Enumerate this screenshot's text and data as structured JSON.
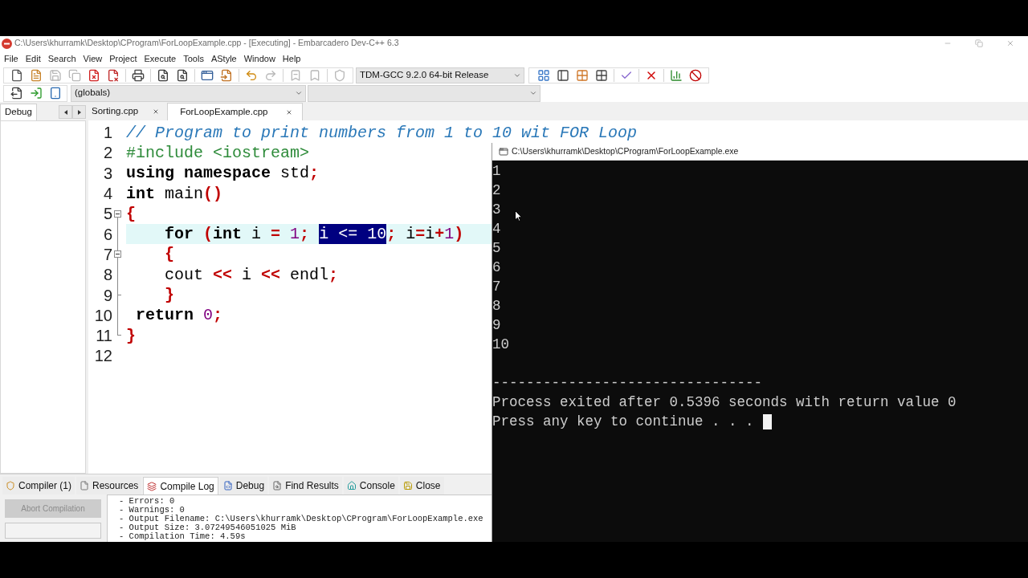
{
  "window": {
    "title": "C:\\Users\\khurramk\\Desktop\\CProgram\\ForLoopExample.cpp - [Executing] - Embarcadero Dev-C++ 6.3"
  },
  "menu": [
    "File",
    "Edit",
    "Search",
    "View",
    "Project",
    "Execute",
    "Tools",
    "AStyle",
    "Window",
    "Help"
  ],
  "main_toolbar": {
    "left_groups": [
      [
        {
          "disabled": false
        },
        {
          "disabled": false
        },
        {
          "disabled": true
        },
        {
          "disabled": true
        },
        {
          "disabled": false
        },
        {
          "disabled": false
        }
      ],
      [
        {
          "disabled": false
        }
      ],
      [
        {
          "disabled": false
        },
        {
          "disabled": false
        }
      ],
      [
        {
          "disabled": false
        },
        {
          "disabled": false
        }
      ],
      [
        {
          "disabled": false
        },
        {
          "disabled": true
        }
      ],
      [
        {
          "disabled": true
        },
        {
          "disabled": true
        }
      ],
      [
        {
          "disabled": true
        }
      ]
    ],
    "compiler": "TDM-GCC 9.2.0 64-bit Release",
    "right_groups": [
      [
        {
          "disabled": false
        },
        {
          "disabled": false
        },
        {
          "disabled": false
        },
        {
          "disabled": false
        }
      ],
      [
        {
          "disabled": false
        }
      ],
      [
        {
          "disabled": false
        }
      ],
      [
        {
          "disabled": false
        },
        {
          "disabled": false
        }
      ]
    ]
  },
  "class_toolbar": {
    "scope": "(globals)"
  },
  "left_panel": {
    "tabs": [
      {
        "label": "Debug",
        "selected": true
      }
    ]
  },
  "editor": {
    "tabs": [
      {
        "label": "Sorting.cpp",
        "selected": false
      },
      {
        "label": "ForLoopExample.cpp",
        "selected": true
      }
    ],
    "lines": [
      {
        "number": "1",
        "current": false,
        "tokens": [
          {
            "kind": "comment",
            "text": "// Program to print numbers from 1 to 10 wit FOR Loop"
          }
        ]
      },
      {
        "number": "2",
        "current": false,
        "tokens": [
          {
            "kind": "preprocessor",
            "text": "#include <iostream>"
          }
        ]
      },
      {
        "number": "3",
        "current": false,
        "tokens": [
          {
            "kind": "keyword",
            "text": "using namespace"
          },
          {
            "kind": "plain",
            "text": " std"
          },
          {
            "kind": "symbol",
            "text": ";"
          }
        ]
      },
      {
        "number": "4",
        "current": false,
        "tokens": [
          {
            "kind": "keyword",
            "text": "int"
          },
          {
            "kind": "plain",
            "text": " main"
          },
          {
            "kind": "symbol",
            "text": "()"
          }
        ]
      },
      {
        "number": "5",
        "current": false,
        "fold": {
          "kind": "start",
          "expanded": true
        },
        "tokens": [
          {
            "kind": "symbol",
            "text": "{"
          }
        ]
      },
      {
        "number": "6",
        "current": true,
        "fold": {
          "kind": "inside"
        },
        "tokens": [
          {
            "kind": "keyword",
            "text": "    for"
          },
          {
            "kind": "symbol",
            "text": " ("
          },
          {
            "kind": "keyword",
            "text": "int"
          },
          {
            "kind": "plain",
            "text": " i "
          },
          {
            "kind": "symbol",
            "text": "="
          },
          {
            "kind": "number",
            "text": " 1"
          },
          {
            "kind": "symbol",
            "text": "; "
          },
          {
            "kind": "selection",
            "text": "i <= 10"
          },
          {
            "kind": "symbol",
            "text": ";"
          },
          {
            "kind": "plain",
            "text": " i"
          },
          {
            "kind": "symbol",
            "text": "="
          },
          {
            "kind": "plain",
            "text": "i"
          },
          {
            "kind": "symbol",
            "text": "+"
          },
          {
            "kind": "number",
            "text": "1"
          },
          {
            "kind": "symbol",
            "text": ")"
          }
        ]
      },
      {
        "number": "7",
        "current": false,
        "fold": {
          "kind": "nested_start",
          "expanded": true
        },
        "tokens": [
          {
            "kind": "symbol",
            "text": "    {"
          }
        ]
      },
      {
        "number": "8",
        "current": false,
        "fold": {
          "kind": "inside"
        },
        "tokens": [
          {
            "kind": "plain",
            "text": "    cout "
          },
          {
            "kind": "symbol",
            "text": "<<"
          },
          {
            "kind": "plain",
            "text": " i "
          },
          {
            "kind": "symbol",
            "text": "<<"
          },
          {
            "kind": "plain",
            "text": " endl"
          },
          {
            "kind": "symbol",
            "text": ";"
          }
        ]
      },
      {
        "number": "9",
        "current": false,
        "fold": {
          "kind": "nested_end"
        },
        "tokens": [
          {
            "kind": "symbol",
            "text": "    }"
          }
        ]
      },
      {
        "number": "10",
        "current": false,
        "fold": {
          "kind": "inside"
        },
        "tokens": [
          {
            "kind": "keyword",
            "text": " return"
          },
          {
            "kind": "number",
            "text": " 0"
          },
          {
            "kind": "symbol",
            "text": ";"
          }
        ]
      },
      {
        "number": "11",
        "current": false,
        "fold": {
          "kind": "end"
        },
        "tokens": [
          {
            "kind": "symbol",
            "text": "}"
          }
        ]
      },
      {
        "number": "12",
        "current": false
      }
    ]
  },
  "console_window": {
    "title": "C:\\Users\\khurramk\\Desktop\\CProgram\\ForLoopExample.exe",
    "output": [
      "1",
      "2",
      "3",
      "4",
      "5",
      "6",
      "7",
      "8",
      "9",
      "10"
    ],
    "separator": "--------------------------------",
    "messages": [
      "Process exited after 0.5396 seconds with return value 0",
      "Press any key to continue . . ."
    ],
    "cursor": true
  },
  "bottom_panel": {
    "tabs": [
      {
        "label": "Compiler (1)",
        "selected": false
      },
      {
        "label": "Resources",
        "selected": false
      },
      {
        "label": "Compile Log",
        "selected": true
      },
      {
        "label": "Debug",
        "selected": false
      },
      {
        "label": "Find Results",
        "selected": false
      },
      {
        "label": "Console",
        "selected": false
      },
      {
        "label": "Close",
        "selected": false
      }
    ],
    "abort_button": {
      "label": "Abort Compilation",
      "disabled": true
    },
    "log": [
      "- Errors: 0",
      "- Warnings: 0",
      "- Output Filename: C:\\Users\\khurramk\\Desktop\\CProgram\\ForLoopExample.exe",
      "- Output Size: 3.07249546051025 MiB",
      "- Compilation Time: 4.59s"
    ]
  }
}
